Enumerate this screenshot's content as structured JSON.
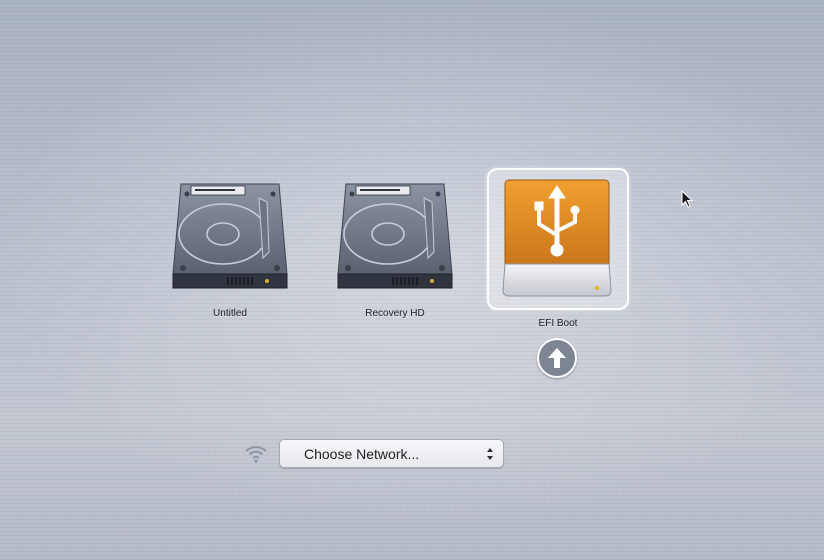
{
  "volumes": [
    {
      "label": "Untitled",
      "icon": "hard-drive-icon",
      "selected": false
    },
    {
      "label": "Recovery HD",
      "icon": "hard-drive-icon",
      "selected": false
    },
    {
      "label": "EFI Boot",
      "icon": "usb-drive-icon",
      "selected": true
    }
  ],
  "network": {
    "label": "Choose Network...",
    "icon": "wifi-icon"
  },
  "colors": {
    "usb_orange": "#e08a1e",
    "selection_border": "#ffffff",
    "boot_button": "#7d8492"
  }
}
